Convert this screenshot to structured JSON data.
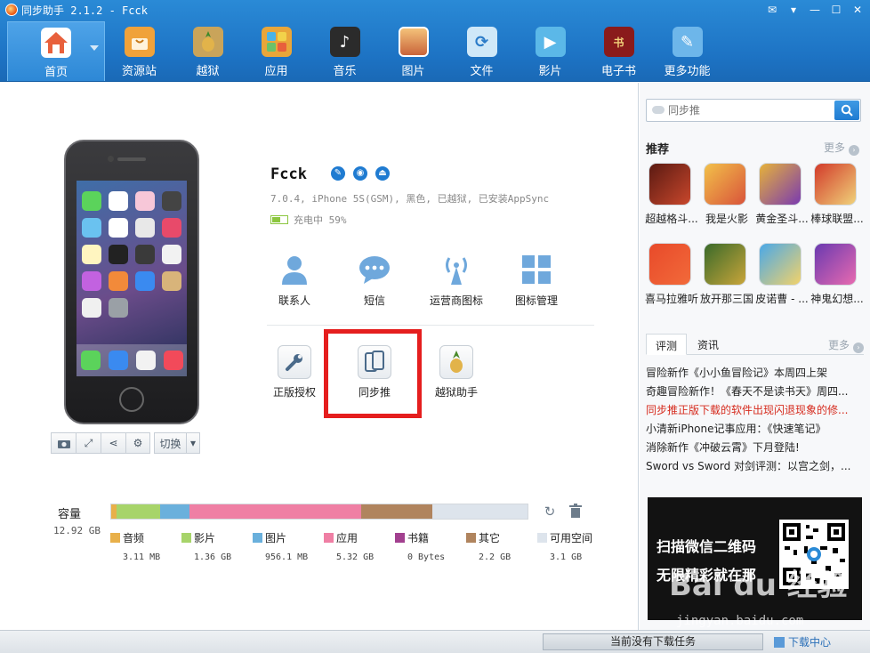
{
  "window": {
    "title": "同步助手 2.1.2 - Fcck",
    "controls": [
      "message-icon",
      "menu-icon",
      "minimize-icon",
      "maximize-icon",
      "close-icon"
    ]
  },
  "nav": {
    "items": [
      {
        "label": "首页",
        "icon": "home-icon",
        "color": "#e8603c",
        "active": true
      },
      {
        "label": "资源站",
        "icon": "shopping-bag-icon",
        "color": "#f0a23a"
      },
      {
        "label": "越狱",
        "icon": "pineapple-icon",
        "color": "#c9a45a"
      },
      {
        "label": "应用",
        "icon": "apps-icon",
        "color": "#e9a63a"
      },
      {
        "label": "音乐",
        "icon": "music-note-icon",
        "color": "#2b2b2b"
      },
      {
        "label": "图片",
        "icon": "photo-icon",
        "color": "#d8865a"
      },
      {
        "label": "文件",
        "icon": "file-icon",
        "color": "#8fc8ef"
      },
      {
        "label": "影片",
        "icon": "play-icon",
        "color": "#5bb8e8"
      },
      {
        "label": "电子书",
        "icon": "book-icon",
        "color": "#8a1b1b"
      },
      {
        "label": "更多功能",
        "icon": "tools-icon",
        "color": "#6db6ea"
      }
    ]
  },
  "device": {
    "name": "Fcck",
    "info": "7.0.4, iPhone 5S(GSM), 黑色, 已越狱, 已安装AppSync",
    "battery_text": "充电中 59%",
    "battery_level": 0.59,
    "toolbar": {
      "switch_label": "切换"
    }
  },
  "functions": [
    {
      "label": "联系人",
      "icon": "contact-icon"
    },
    {
      "label": "短信",
      "icon": "sms-icon"
    },
    {
      "label": "运营商图标",
      "icon": "carrier-signal-icon"
    },
    {
      "label": "图标管理",
      "icon": "icon-grid-icon"
    }
  ],
  "tools": [
    {
      "label": "正版授权",
      "icon": "wrench-icon"
    },
    {
      "label": "同步推",
      "icon": "tongbutui-icon"
    },
    {
      "label": "越狱助手",
      "icon": "pineapple-icon"
    }
  ],
  "capacity": {
    "label": "容量",
    "total": "12.92 GB",
    "segments": [
      {
        "name": "音频",
        "value": "3.11 MB",
        "color": "#e8b04a",
        "fraction": 0.012
      },
      {
        "name": "影片",
        "value": "1.36 GB",
        "color": "#a7d46a",
        "fraction": 0.105
      },
      {
        "name": "图片",
        "value": "956.1 MB",
        "color": "#6ab0dc",
        "fraction": 0.072
      },
      {
        "name": "应用",
        "value": "5.32 GB",
        "color": "#ef7fa4",
        "fraction": 0.412
      },
      {
        "name": "书籍",
        "value": "0 Bytes",
        "color": "#a2408f",
        "fraction": 0.0
      },
      {
        "name": "其它",
        "value": "2.2 GB",
        "color": "#b0845e",
        "fraction": 0.17
      },
      {
        "name": "可用空间",
        "value": "3.1 GB",
        "color": "#dde4ec",
        "fraction": 0.229
      }
    ]
  },
  "right": {
    "search_placeholder": "同步推",
    "recommend_title": "推荐",
    "more_label": "更多",
    "apps": [
      {
        "name": "超越格斗...",
        "colors": [
          "#5a1a12",
          "#c9472c"
        ]
      },
      {
        "name": "我是火影",
        "colors": [
          "#f2c14a",
          "#d9533a"
        ]
      },
      {
        "name": "黄金圣斗...",
        "colors": [
          "#e6b23a",
          "#7a3ab0"
        ]
      },
      {
        "name": "棒球联盟...",
        "colors": [
          "#d23a2a",
          "#f0d27a"
        ]
      },
      {
        "name": "喜马拉雅听",
        "colors": [
          "#e84a2a",
          "#f26a3a"
        ]
      },
      {
        "name": "放开那三国",
        "colors": [
          "#3a6a2a",
          "#c9a53a"
        ]
      },
      {
        "name": "皮诺曹 - ...",
        "colors": [
          "#4aa8e8",
          "#f2d26a"
        ]
      },
      {
        "name": "神鬼幻想...",
        "colors": [
          "#6a3ab0",
          "#e86ab0"
        ]
      }
    ],
    "tabs": [
      {
        "label": "评测",
        "active": true
      },
      {
        "label": "资讯",
        "active": false
      }
    ],
    "news": [
      {
        "text": "冒险新作《小小鱼冒险记》本周四上架",
        "hot": false
      },
      {
        "text": "奇趣冒险新作！《春天不是读书天》周四...",
        "hot": false
      },
      {
        "text": "同步推正版下载的软件出现闪退现象的修...",
        "hot": true
      },
      {
        "text": "小清新iPhone记事应用：《快速笔记》",
        "hot": false
      },
      {
        "text": "消除新作《冲破云霄》下月登陆!",
        "hot": false
      },
      {
        "text": "Sword vs Sword 对剑评测：以宫之剑，...",
        "hot": false
      }
    ],
    "banner": {
      "line1": "扫描微信二维码",
      "line2": "无限精彩就在那"
    },
    "watermark": "Bai du 经验",
    "watermark_url": "jingyan.baidu.com"
  },
  "status": {
    "download_status": "当前没有下载任务",
    "download_center": "下载中心"
  }
}
